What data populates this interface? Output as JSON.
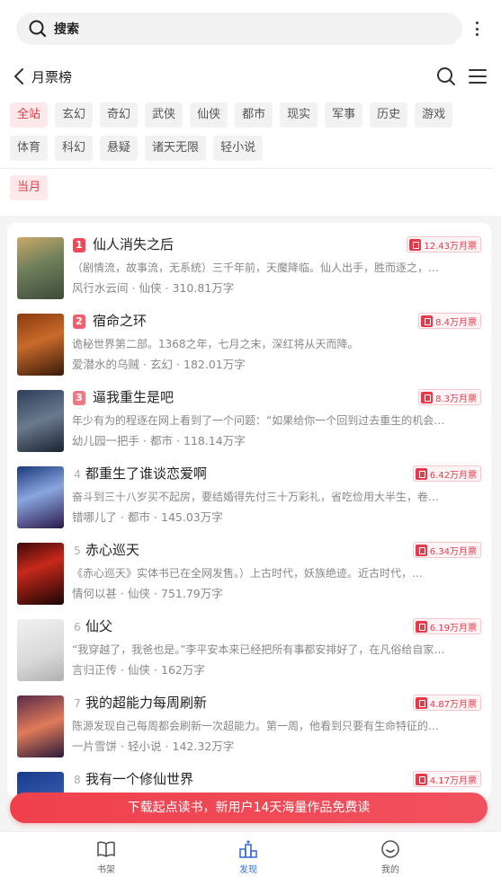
{
  "search": {
    "label": "搜索"
  },
  "nav": {
    "title": "月票榜"
  },
  "category_tags": [
    [
      "全站",
      "玄幻",
      "奇幻",
      "武侠",
      "仙侠",
      "都市",
      "现实",
      "军事",
      "历史",
      "游戏"
    ],
    [
      "体育",
      "科幻",
      "悬疑",
      "诸天无限",
      "轻小说"
    ]
  ],
  "active_tag": "全站",
  "period": {
    "label": "当月"
  },
  "books": [
    {
      "rank": "1",
      "title": "仙人消失之后",
      "tickets": "12.43万月票",
      "desc": "（剧情流，故事流，无系统）三千年前，天魔降临。仙人出手，胜而逐之，…",
      "author": "风行水云间",
      "genre": "仙侠",
      "words": "310.81万字"
    },
    {
      "rank": "2",
      "title": "宿命之环",
      "tickets": "8.4万月票",
      "desc": "诡秘世界第二部。1368之年，七月之末，深红将从天而降。",
      "author": "爱潜水的乌贼",
      "genre": "玄幻",
      "words": "182.01万字"
    },
    {
      "rank": "3",
      "title": "逼我重生是吧",
      "tickets": "8.3万月票",
      "desc": "年少有为的程逐在网上看到了一个问题：“如果给你一个回到过去重生的机会…",
      "author": "幼儿园一把手",
      "genre": "都市",
      "words": "118.14万字"
    },
    {
      "rank": "4",
      "title": "都重生了谁谈恋爱啊",
      "tickets": "6.42万月票",
      "desc": "奋斗到三十八岁买不起房，要结婚得先付三十万彩礼，省吃俭用大半生，卷…",
      "author": "错哪儿了",
      "genre": "都市",
      "words": "145.03万字"
    },
    {
      "rank": "5",
      "title": "赤心巡天",
      "tickets": "6.34万月票",
      "desc": "《赤心巡天》实体书已在全网发售。）上古时代，妖族绝迹。近古时代，…",
      "author": "情何以甚",
      "genre": "仙侠",
      "words": "751.79万字"
    },
    {
      "rank": "6",
      "title": "仙父",
      "tickets": "6.19万月票",
      "desc": "“我穿越了，我爸也是。”李平安本来已经把所有事都安排好了，在凡俗给自家…",
      "author": "言归正传",
      "genre": "仙侠",
      "words": "162万字"
    },
    {
      "rank": "7",
      "title": "我的超能力每周刷新",
      "tickets": "4.87万月票",
      "desc": "陈源发现自己每周都会刷新一次超能力。第一周，他看到只要有生命特征的…",
      "author": "一片雪饼",
      "genre": "轻小说",
      "words": "142.32万字"
    },
    {
      "rank": "8",
      "title": "我有一个修仙世界",
      "tickets": "4.17万月票",
      "desc": "",
      "author": "",
      "genre": "",
      "words": ""
    }
  ],
  "sep": "·",
  "banner": {
    "text": "下载起点读书，新用户14天海量作品免费读"
  },
  "tabs": [
    {
      "label": "书架"
    },
    {
      "label": "发现"
    },
    {
      "label": "我的"
    }
  ],
  "colors": {
    "accent": "#e8394a",
    "tab_active": "#3b6fd8"
  }
}
